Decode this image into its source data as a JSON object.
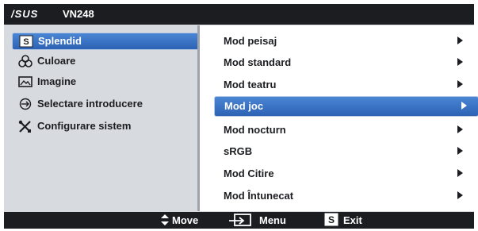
{
  "title": {
    "brand": "/SUS",
    "model": "VN248"
  },
  "left_menu": [
    {
      "label": "Splendid",
      "icon": "splendid-icon",
      "active": true
    },
    {
      "label": "Culoare",
      "icon": "color-icon",
      "active": false
    },
    {
      "label": "Imagine",
      "icon": "image-icon",
      "active": false
    },
    {
      "label": "Selectare introducere",
      "icon": "input-select-icon",
      "active": false
    },
    {
      "label": "Configurare sistem",
      "icon": "system-setup-icon",
      "active": false
    }
  ],
  "right_menu": [
    {
      "label": "Mod peisaj",
      "active": false
    },
    {
      "label": "Mod standard",
      "active": false
    },
    {
      "label": "Mod teatru",
      "active": false
    },
    {
      "label": "Mod joc",
      "active": true
    },
    {
      "label": "Mod nocturn",
      "active": false
    },
    {
      "label": "sRGB",
      "active": false
    },
    {
      "label": "Mod Citire",
      "active": false
    },
    {
      "label": "Mod Întunecat",
      "active": false
    }
  ],
  "footer": {
    "move": "Move",
    "menu": "Menu",
    "exit": "Exit",
    "exit_key": "S"
  },
  "colors": {
    "accent": "#3a74c4",
    "bar": "#1b1d20",
    "panel": "#d7dade"
  }
}
